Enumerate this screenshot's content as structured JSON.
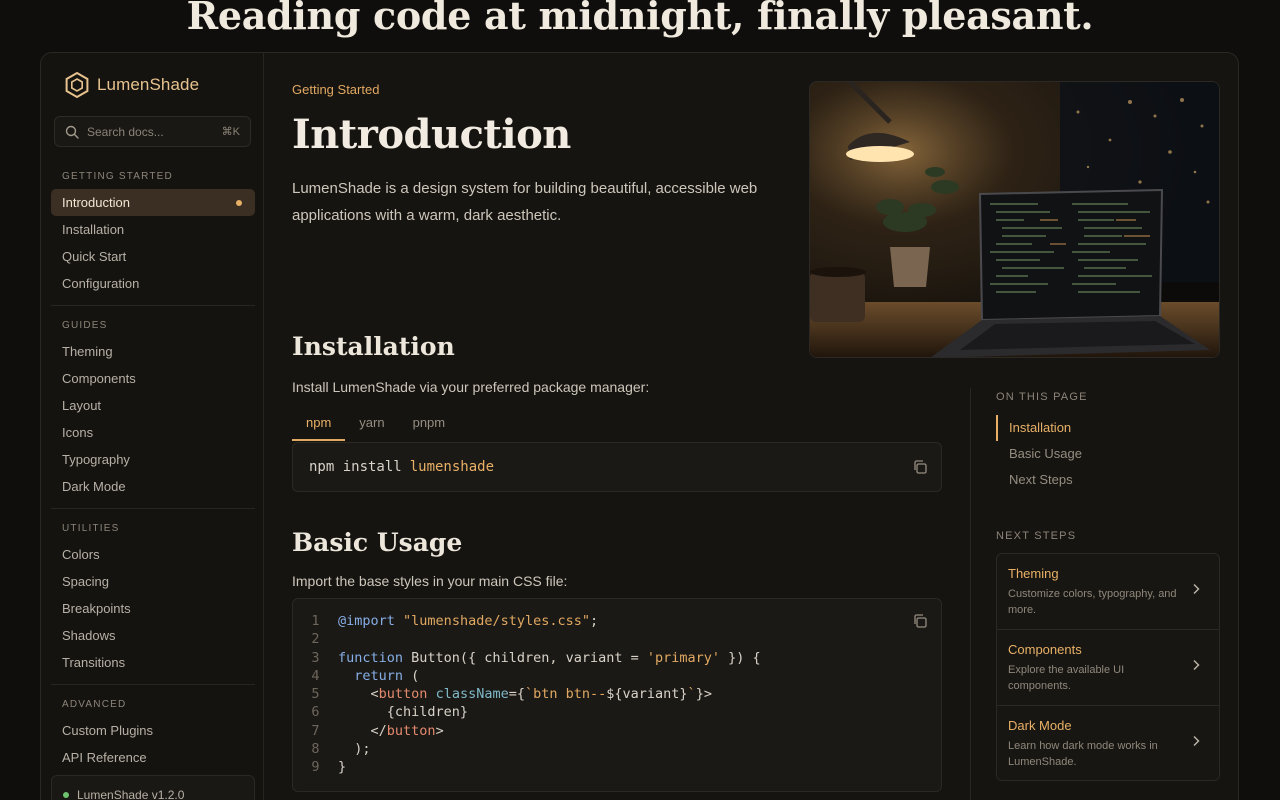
{
  "hero": {
    "title": "Reading code at midnight, finally pleasant."
  },
  "brand": {
    "name": "LumenShade"
  },
  "search": {
    "placeholder": "Search docs...",
    "shortcut": "⌘K"
  },
  "sidebar": {
    "sections": [
      {
        "title": "GETTING STARTED",
        "items": [
          "Introduction",
          "Installation",
          "Quick Start",
          "Configuration"
        ]
      },
      {
        "title": "GUIDES",
        "items": [
          "Theming",
          "Components",
          "Layout",
          "Icons",
          "Typography",
          "Dark Mode"
        ]
      },
      {
        "title": "UTILITIES",
        "items": [
          "Colors",
          "Spacing",
          "Breakpoints",
          "Shadows",
          "Transitions"
        ]
      },
      {
        "title": "ADVANCED",
        "items": [
          "Custom Plugins",
          "API Reference"
        ]
      }
    ],
    "active_item": "Introduction",
    "version": "LumenShade v1.2.0"
  },
  "main": {
    "eyebrow": "Getting Started",
    "title": "Introduction",
    "lead": "LumenShade is a design system for building beautiful, accessible web applications with a warm, dark aesthetic.",
    "installation": {
      "heading": "Installation",
      "text": "Install LumenShade via your preferred package manager:",
      "tabs": [
        "npm",
        "yarn",
        "pnpm"
      ],
      "active_tab": "npm",
      "command": "npm install",
      "package": "lumenshade"
    },
    "usage": {
      "heading": "Basic Usage",
      "text": "Import the base styles in your main CSS file:",
      "line_numbers": [
        "1",
        "2",
        "3",
        "4",
        "5",
        "6",
        "7",
        "8",
        "9"
      ]
    }
  },
  "rail": {
    "toc_title": "ON THIS PAGE",
    "toc": [
      "Installation",
      "Basic Usage",
      "Next Steps"
    ],
    "toc_active": "Installation",
    "next_title": "NEXT STEPS",
    "next_steps": [
      {
        "title": "Theming",
        "desc": "Customize colors, typography, and more."
      },
      {
        "title": "Components",
        "desc": "Explore the available UI components."
      },
      {
        "title": "Dark Mode",
        "desc": "Learn how dark mode works in LumenShade."
      }
    ]
  },
  "colors": {
    "accent": "#e8b066",
    "background": "#0f0e0c",
    "surface": "#161411",
    "status_ok": "#6ec26e"
  },
  "icons": [
    "hexagon-logo-icon",
    "search-icon",
    "copy-icon",
    "chevron-right-icon"
  ]
}
